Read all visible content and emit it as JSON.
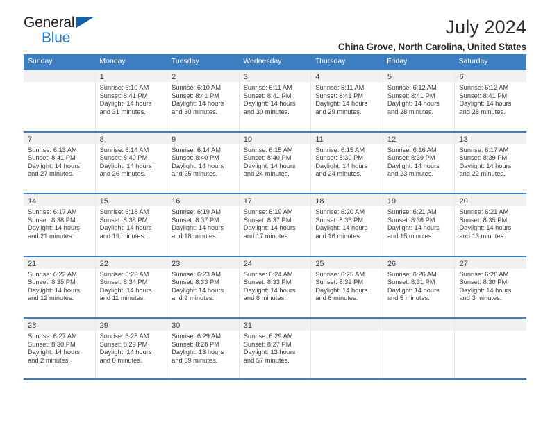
{
  "brand": {
    "name_part1": "General",
    "name_part2": "Blue",
    "flag_icon": "triangle-flag-icon",
    "accent_color": "#1e78c8"
  },
  "header": {
    "title": "July 2024",
    "location": "China Grove, North Carolina, United States"
  },
  "calendar": {
    "header_bg_color": "#3c7ebf",
    "row_border_color": "#3c7ebf",
    "day_band_color": "#f1f1f1",
    "weekdays": [
      "Sunday",
      "Monday",
      "Tuesday",
      "Wednesday",
      "Thursday",
      "Friday",
      "Saturday"
    ],
    "labels": {
      "sunrise": "Sunrise:",
      "sunset": "Sunset:",
      "daylight": "Daylight:"
    },
    "weeks": [
      [
        {
          "day": "",
          "sunrise": "",
          "sunset": "",
          "daylight_a": "",
          "daylight_b": ""
        },
        {
          "day": "1",
          "sunrise": "Sunrise: 6:10 AM",
          "sunset": "Sunset: 8:41 PM",
          "daylight_a": "Daylight: 14 hours",
          "daylight_b": "and 31 minutes."
        },
        {
          "day": "2",
          "sunrise": "Sunrise: 6:10 AM",
          "sunset": "Sunset: 8:41 PM",
          "daylight_a": "Daylight: 14 hours",
          "daylight_b": "and 30 minutes."
        },
        {
          "day": "3",
          "sunrise": "Sunrise: 6:11 AM",
          "sunset": "Sunset: 8:41 PM",
          "daylight_a": "Daylight: 14 hours",
          "daylight_b": "and 30 minutes."
        },
        {
          "day": "4",
          "sunrise": "Sunrise: 6:11 AM",
          "sunset": "Sunset: 8:41 PM",
          "daylight_a": "Daylight: 14 hours",
          "daylight_b": "and 29 minutes."
        },
        {
          "day": "5",
          "sunrise": "Sunrise: 6:12 AM",
          "sunset": "Sunset: 8:41 PM",
          "daylight_a": "Daylight: 14 hours",
          "daylight_b": "and 28 minutes."
        },
        {
          "day": "6",
          "sunrise": "Sunrise: 6:12 AM",
          "sunset": "Sunset: 8:41 PM",
          "daylight_a": "Daylight: 14 hours",
          "daylight_b": "and 28 minutes."
        }
      ],
      [
        {
          "day": "7",
          "sunrise": "Sunrise: 6:13 AM",
          "sunset": "Sunset: 8:41 PM",
          "daylight_a": "Daylight: 14 hours",
          "daylight_b": "and 27 minutes."
        },
        {
          "day": "8",
          "sunrise": "Sunrise: 6:14 AM",
          "sunset": "Sunset: 8:40 PM",
          "daylight_a": "Daylight: 14 hours",
          "daylight_b": "and 26 minutes."
        },
        {
          "day": "9",
          "sunrise": "Sunrise: 6:14 AM",
          "sunset": "Sunset: 8:40 PM",
          "daylight_a": "Daylight: 14 hours",
          "daylight_b": "and 25 minutes."
        },
        {
          "day": "10",
          "sunrise": "Sunrise: 6:15 AM",
          "sunset": "Sunset: 8:40 PM",
          "daylight_a": "Daylight: 14 hours",
          "daylight_b": "and 24 minutes."
        },
        {
          "day": "11",
          "sunrise": "Sunrise: 6:15 AM",
          "sunset": "Sunset: 8:39 PM",
          "daylight_a": "Daylight: 14 hours",
          "daylight_b": "and 24 minutes."
        },
        {
          "day": "12",
          "sunrise": "Sunrise: 6:16 AM",
          "sunset": "Sunset: 8:39 PM",
          "daylight_a": "Daylight: 14 hours",
          "daylight_b": "and 23 minutes."
        },
        {
          "day": "13",
          "sunrise": "Sunrise: 6:17 AM",
          "sunset": "Sunset: 8:39 PM",
          "daylight_a": "Daylight: 14 hours",
          "daylight_b": "and 22 minutes."
        }
      ],
      [
        {
          "day": "14",
          "sunrise": "Sunrise: 6:17 AM",
          "sunset": "Sunset: 8:38 PM",
          "daylight_a": "Daylight: 14 hours",
          "daylight_b": "and 21 minutes."
        },
        {
          "day": "15",
          "sunrise": "Sunrise: 6:18 AM",
          "sunset": "Sunset: 8:38 PM",
          "daylight_a": "Daylight: 14 hours",
          "daylight_b": "and 19 minutes."
        },
        {
          "day": "16",
          "sunrise": "Sunrise: 6:19 AM",
          "sunset": "Sunset: 8:37 PM",
          "daylight_a": "Daylight: 14 hours",
          "daylight_b": "and 18 minutes."
        },
        {
          "day": "17",
          "sunrise": "Sunrise: 6:19 AM",
          "sunset": "Sunset: 8:37 PM",
          "daylight_a": "Daylight: 14 hours",
          "daylight_b": "and 17 minutes."
        },
        {
          "day": "18",
          "sunrise": "Sunrise: 6:20 AM",
          "sunset": "Sunset: 8:36 PM",
          "daylight_a": "Daylight: 14 hours",
          "daylight_b": "and 16 minutes."
        },
        {
          "day": "19",
          "sunrise": "Sunrise: 6:21 AM",
          "sunset": "Sunset: 8:36 PM",
          "daylight_a": "Daylight: 14 hours",
          "daylight_b": "and 15 minutes."
        },
        {
          "day": "20",
          "sunrise": "Sunrise: 6:21 AM",
          "sunset": "Sunset: 8:35 PM",
          "daylight_a": "Daylight: 14 hours",
          "daylight_b": "and 13 minutes."
        }
      ],
      [
        {
          "day": "21",
          "sunrise": "Sunrise: 6:22 AM",
          "sunset": "Sunset: 8:35 PM",
          "daylight_a": "Daylight: 14 hours",
          "daylight_b": "and 12 minutes."
        },
        {
          "day": "22",
          "sunrise": "Sunrise: 6:23 AM",
          "sunset": "Sunset: 8:34 PM",
          "daylight_a": "Daylight: 14 hours",
          "daylight_b": "and 11 minutes."
        },
        {
          "day": "23",
          "sunrise": "Sunrise: 6:23 AM",
          "sunset": "Sunset: 8:33 PM",
          "daylight_a": "Daylight: 14 hours",
          "daylight_b": "and 9 minutes."
        },
        {
          "day": "24",
          "sunrise": "Sunrise: 6:24 AM",
          "sunset": "Sunset: 8:33 PM",
          "daylight_a": "Daylight: 14 hours",
          "daylight_b": "and 8 minutes."
        },
        {
          "day": "25",
          "sunrise": "Sunrise: 6:25 AM",
          "sunset": "Sunset: 8:32 PM",
          "daylight_a": "Daylight: 14 hours",
          "daylight_b": "and 6 minutes."
        },
        {
          "day": "26",
          "sunrise": "Sunrise: 6:26 AM",
          "sunset": "Sunset: 8:31 PM",
          "daylight_a": "Daylight: 14 hours",
          "daylight_b": "and 5 minutes."
        },
        {
          "day": "27",
          "sunrise": "Sunrise: 6:26 AM",
          "sunset": "Sunset: 8:30 PM",
          "daylight_a": "Daylight: 14 hours",
          "daylight_b": "and 3 minutes."
        }
      ],
      [
        {
          "day": "28",
          "sunrise": "Sunrise: 6:27 AM",
          "sunset": "Sunset: 8:30 PM",
          "daylight_a": "Daylight: 14 hours",
          "daylight_b": "and 2 minutes."
        },
        {
          "day": "29",
          "sunrise": "Sunrise: 6:28 AM",
          "sunset": "Sunset: 8:29 PM",
          "daylight_a": "Daylight: 14 hours",
          "daylight_b": "and 0 minutes."
        },
        {
          "day": "30",
          "sunrise": "Sunrise: 6:29 AM",
          "sunset": "Sunset: 8:28 PM",
          "daylight_a": "Daylight: 13 hours",
          "daylight_b": "and 59 minutes."
        },
        {
          "day": "31",
          "sunrise": "Sunrise: 6:29 AM",
          "sunset": "Sunset: 8:27 PM",
          "daylight_a": "Daylight: 13 hours",
          "daylight_b": "and 57 minutes."
        },
        {
          "day": "",
          "sunrise": "",
          "sunset": "",
          "daylight_a": "",
          "daylight_b": ""
        },
        {
          "day": "",
          "sunrise": "",
          "sunset": "",
          "daylight_a": "",
          "daylight_b": ""
        },
        {
          "day": "",
          "sunrise": "",
          "sunset": "",
          "daylight_a": "",
          "daylight_b": ""
        }
      ]
    ]
  }
}
